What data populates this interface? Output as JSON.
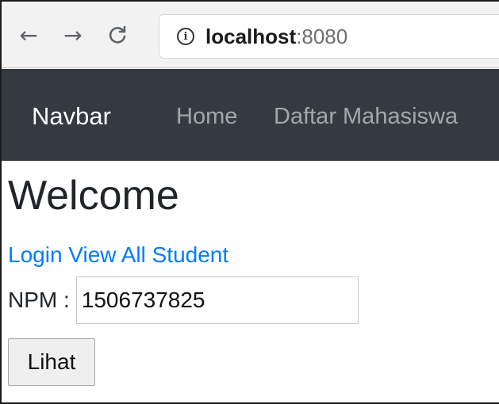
{
  "browser": {
    "back_glyph": "←",
    "forward_glyph": "→",
    "reload_glyph": "C",
    "info_glyph": "i",
    "url_host": "localhost",
    "url_port": ":8080"
  },
  "navbar": {
    "brand": "Navbar",
    "links": [
      "Home",
      "Daftar Mahasiswa"
    ],
    "background": "#343a40"
  },
  "main": {
    "title": "Welcome",
    "links": [
      "Login",
      "View All Student"
    ],
    "npm_label": "NPM :",
    "npm_value": "1506737825",
    "submit_label": "Lihat",
    "link_color": "#007bff"
  }
}
